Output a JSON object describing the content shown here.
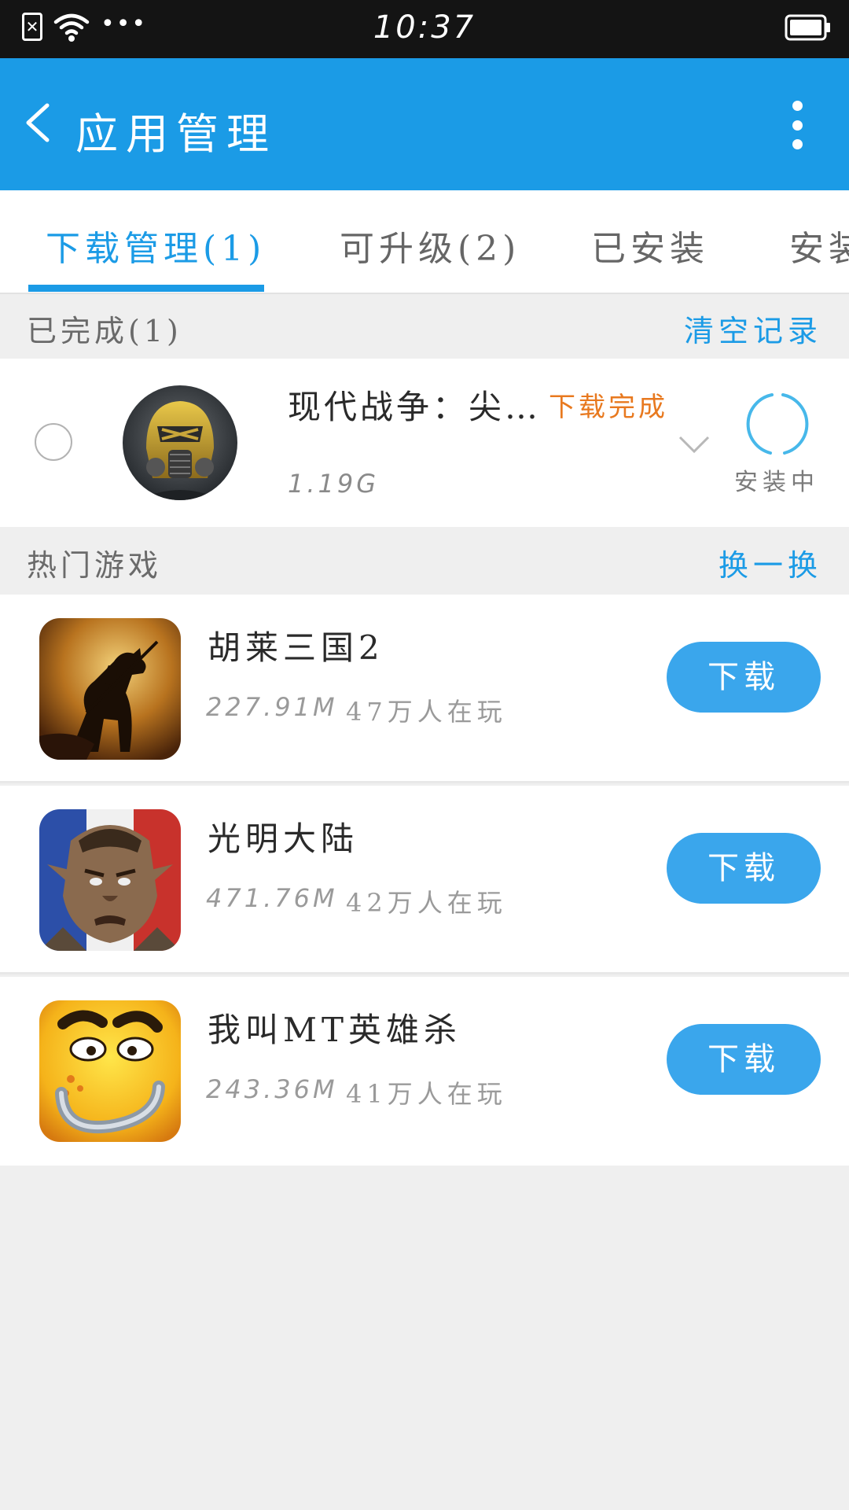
{
  "status_bar": {
    "time": "10:37"
  },
  "app_bar": {
    "title": "应用管理"
  },
  "tabs": [
    {
      "label": "下载管理(1)",
      "active": true
    },
    {
      "label": "可升级(2)",
      "active": false
    },
    {
      "label": "已安装",
      "active": false
    },
    {
      "label": "安装",
      "active": false
    }
  ],
  "completed_section": {
    "label": "已完成(1)",
    "action": "清空记录"
  },
  "download_item": {
    "name": "现代战争：尖…",
    "status": "下载完成",
    "size": "1.19G",
    "install_status": "安装中"
  },
  "hot_section": {
    "label": "热门游戏",
    "action": "换一换"
  },
  "games": [
    {
      "name": "胡莱三国2",
      "size": "227.91M",
      "players": "47万人在玩",
      "button": "下载",
      "icon": "horse-rider-icon"
    },
    {
      "name": "光明大陆",
      "size": "471.76M",
      "players": "42万人在玩",
      "button": "下载",
      "icon": "orc-warrior-icon"
    },
    {
      "name": "我叫MT英雄杀",
      "size": "243.36M",
      "players": "41万人在玩",
      "button": "下载",
      "icon": "yellow-face-icon"
    }
  ],
  "colors": {
    "primary": "#1b9be6",
    "accent_orange": "#e8791f",
    "button": "#3aa6ec"
  }
}
